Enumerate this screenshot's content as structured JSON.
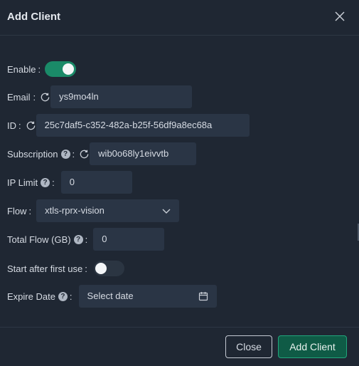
{
  "modal": {
    "title": "Add Client"
  },
  "form": {
    "enable": {
      "label": "Enable",
      "colon": ":",
      "value": true
    },
    "email": {
      "label": "Email",
      "colon": ":",
      "value": "ys9mo4ln"
    },
    "id": {
      "label": "ID",
      "colon": ":",
      "value": "25c7daf5-c352-482a-b25f-56df9a8ec68a"
    },
    "subscription": {
      "label": "Subscription",
      "help": "?",
      "colon": ":",
      "value": "wib0o68ly1eivvtb"
    },
    "ip_limit": {
      "label": "IP Limit",
      "help": "?",
      "colon": ":",
      "value": "0"
    },
    "flow": {
      "label": "Flow",
      "colon": ":",
      "value": "xtls-rprx-vision"
    },
    "total_flow": {
      "label": "Total Flow (GB)",
      "help": "?",
      "colon": ":",
      "value": "0"
    },
    "start_after_first_use": {
      "label": "Start after first use",
      "colon": ":",
      "value": false
    },
    "expire_date": {
      "label": "Expire Date",
      "help": "?",
      "colon": ":",
      "placeholder": "Select date"
    }
  },
  "footer": {
    "close_label": "Close",
    "add_label": "Add Client"
  },
  "colors": {
    "background": "#1f2733",
    "input_bg": "#2a3545",
    "accent_green": "#1a8a68",
    "primary_button": "#0f5b46"
  },
  "icons": [
    "close-icon",
    "refresh-icon",
    "help-icon",
    "chevron-down-icon",
    "calendar-icon"
  ]
}
